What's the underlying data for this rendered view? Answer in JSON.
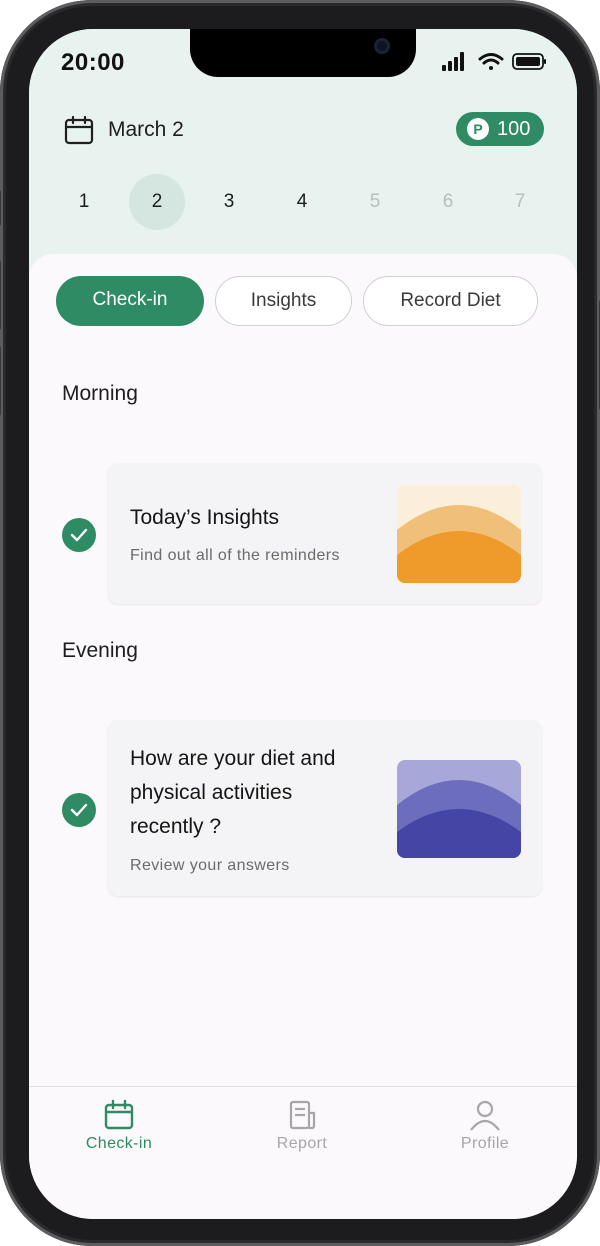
{
  "status_bar": {
    "time": "20:00"
  },
  "header": {
    "date": "March 2",
    "points": "100",
    "points_icon_letter": "P",
    "days": [
      {
        "label": "1",
        "state": "past"
      },
      {
        "label": "2",
        "state": "selected"
      },
      {
        "label": "3",
        "state": "past"
      },
      {
        "label": "4",
        "state": "past"
      },
      {
        "label": "5",
        "state": "future"
      },
      {
        "label": "6",
        "state": "future"
      },
      {
        "label": "7",
        "state": "future"
      }
    ]
  },
  "tabs": [
    {
      "label": "Check-in",
      "active": true
    },
    {
      "label": "Insights",
      "active": false
    },
    {
      "label": "Record Diet",
      "active": false
    }
  ],
  "sections": [
    {
      "title": "Morning",
      "card": {
        "title": "Today’s Insights",
        "subtitle": "Find out all of the reminders",
        "completed": true,
        "art": "sunrise-orange"
      }
    },
    {
      "title": "Evening",
      "card": {
        "title": "How are your diet and physical activities recently ?",
        "title_lines": [
          "How are your diet and",
          "physical activities",
          "recently ?"
        ],
        "subtitle": "Review your answers",
        "completed": true,
        "art": "dusk-purple"
      }
    }
  ],
  "bottom_nav": [
    {
      "label": "Check-in",
      "icon": "calendar-icon",
      "active": true
    },
    {
      "label": "Report",
      "icon": "report-icon",
      "active": false
    },
    {
      "label": "Profile",
      "icon": "profile-icon",
      "active": false
    }
  ],
  "colors": {
    "accent": "#2e8b63",
    "header_bg": "#e8f2ef",
    "selected_day_bg": "#d5e5e0",
    "inactive_nav": "#a6a6a9",
    "orange_art": "#ee9b2c",
    "purple_art": "#4a4aa8"
  }
}
